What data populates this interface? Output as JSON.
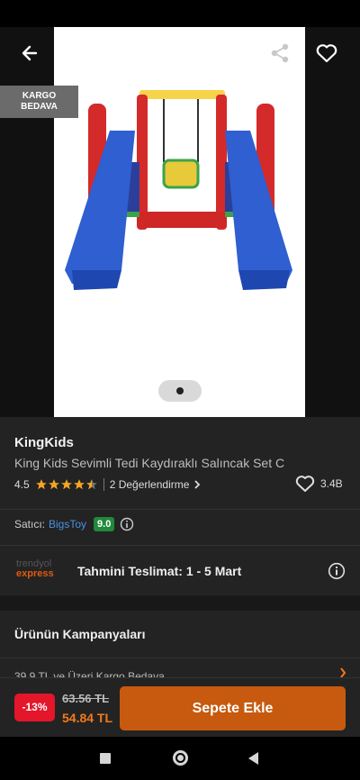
{
  "hero": {
    "cargo_badge_line1": "KARGO",
    "cargo_badge_line2": "BEDAVA",
    "image_index": 1,
    "image_total": 1
  },
  "product": {
    "brand": "KingKids",
    "name": "King Kids Sevimli Tedi Kaydıraklı Salıncak Set C",
    "rating": "4.5",
    "rating_value": 4.5,
    "reviews": "2 Değerlendirme",
    "likes": "3.4B"
  },
  "seller": {
    "label": "Satıcı:",
    "name": "BigsToy",
    "score": "9.0"
  },
  "delivery": {
    "logo_top": "trendyol",
    "logo_bottom": "express",
    "text": "Tahmini Teslimat: 1 - 5 Mart"
  },
  "campaigns": {
    "title": "Ürünün Kampanyaları",
    "item": "39,9 TL ve Üzeri Kargo Bedava"
  },
  "purchase": {
    "discount": "-13%",
    "old_price": "63.56 TL",
    "new_price": "54.84 TL",
    "cart_button": "Sepete Ekle"
  },
  "colors": {
    "accent": "#f27a1a",
    "button": "#c75a0e",
    "discount": "#e3162a",
    "star": "#f5a623",
    "seller_link": "#4a90e2",
    "score": "#1f8a3a"
  }
}
